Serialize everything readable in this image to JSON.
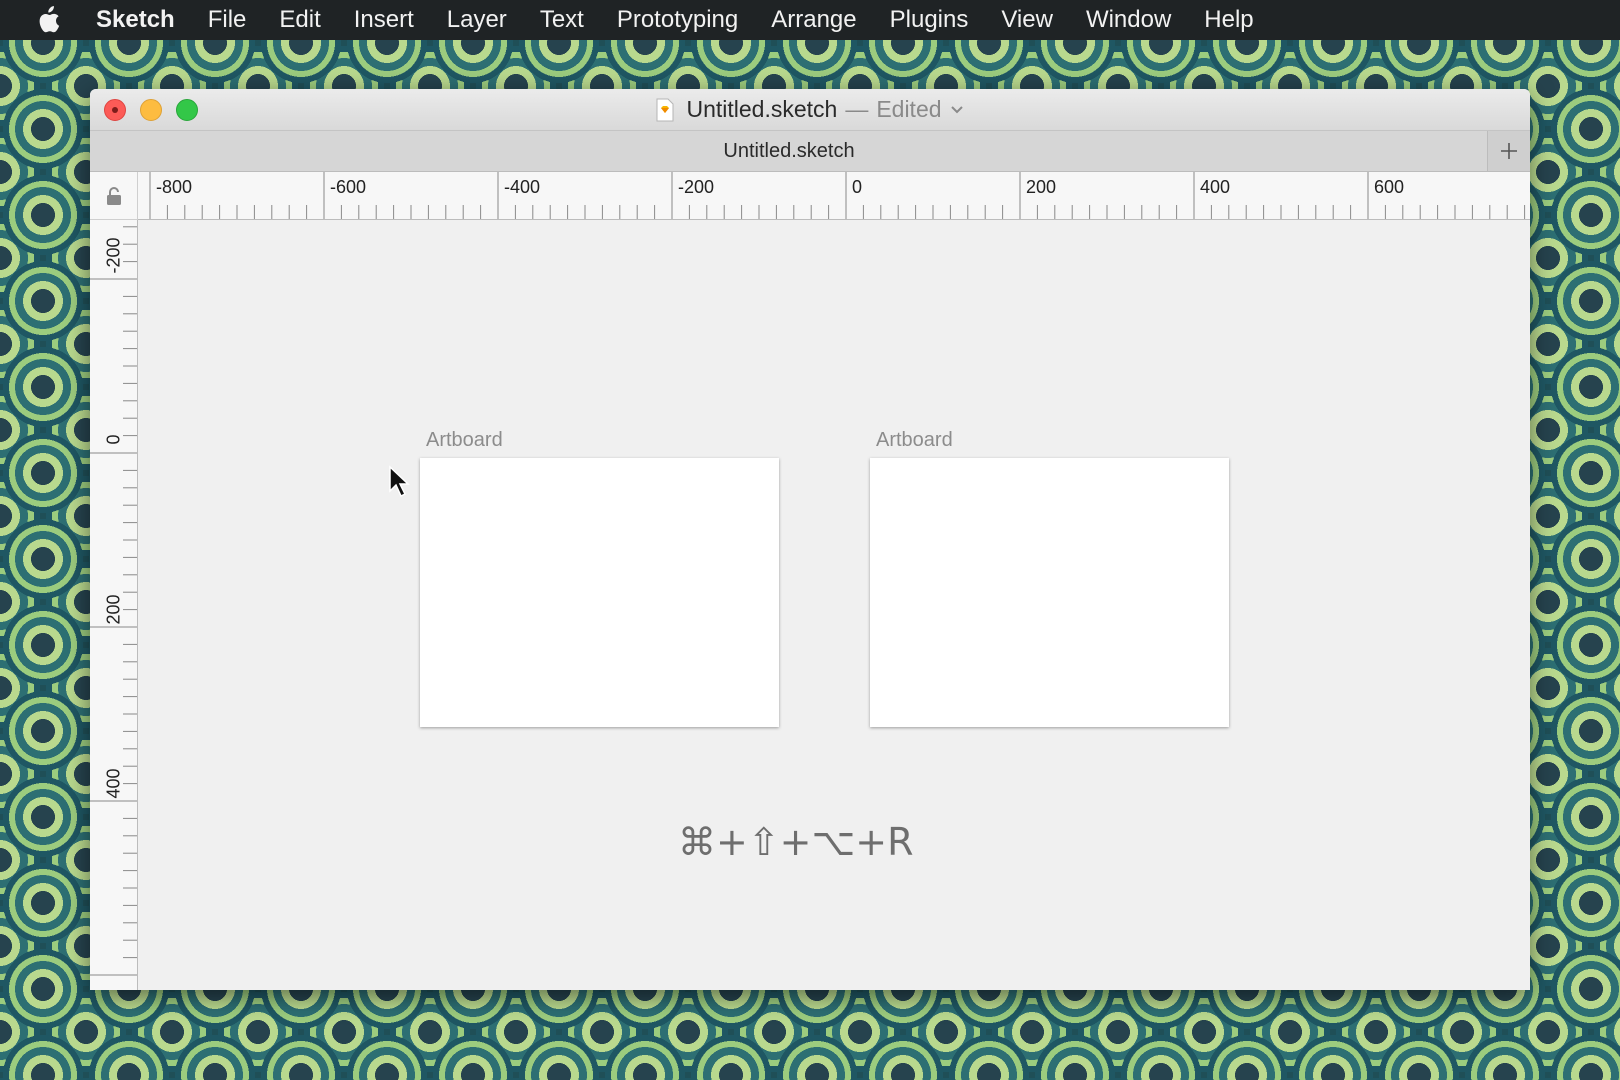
{
  "menubar": {
    "app_name": "Sketch",
    "items": [
      "File",
      "Edit",
      "Insert",
      "Layer",
      "Text",
      "Prototyping",
      "Arrange",
      "Plugins",
      "View",
      "Window",
      "Help"
    ]
  },
  "window": {
    "doc_title": "Untitled.sketch",
    "title_separator": "—",
    "edited_label": "Edited",
    "tab_title": "Untitled.sketch"
  },
  "rulers": {
    "horizontal": [
      "-800",
      "-600",
      "-400",
      "-200",
      "0",
      "200",
      "400",
      "600"
    ],
    "vertical": [
      "-200",
      "0",
      "200",
      "400"
    ]
  },
  "canvas": {
    "artboards": [
      {
        "label": "Artboard"
      },
      {
        "label": "Artboard"
      }
    ],
    "shortcut_hint": "⌘+⇧+⌥+R"
  },
  "colors": {
    "close": "#fc5b57",
    "minimize": "#fdbc40",
    "maximize": "#33c748",
    "menubar_bg": "#1f2325",
    "canvas_bg": "#f0f0f0"
  },
  "icons": {
    "apple": "apple-icon",
    "document": "sketch-document-icon",
    "lock": "lock-icon",
    "add": "plus-icon",
    "cursor": "pointer-cursor-icon"
  }
}
